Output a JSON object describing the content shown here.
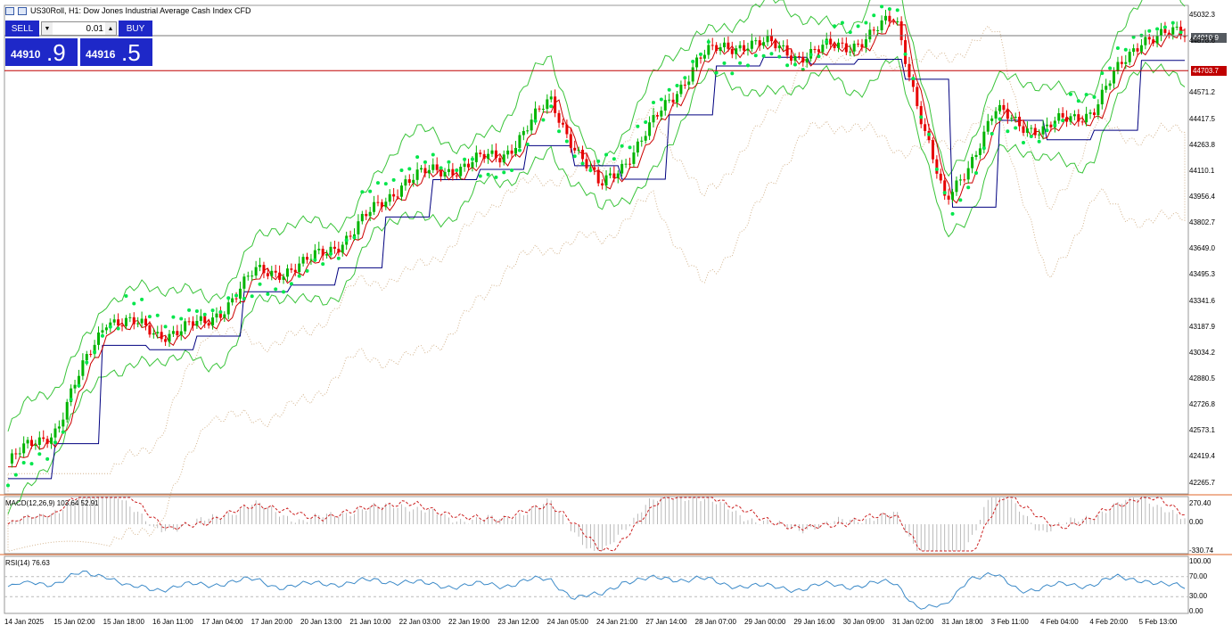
{
  "window": {
    "title": "US30Roll, H1:  Dow Jones Industrial Average Cash Index CFD"
  },
  "trade_panel": {
    "sell_label": "SELL",
    "buy_label": "BUY",
    "lot_value": "0.01",
    "bid_small": "44910",
    "bid_big": ".9",
    "ask_small": "44916",
    "ask_big": ".5",
    "colors": {
      "button": "#1e28c8",
      "text": "#ffffff"
    }
  },
  "main_chart": {
    "y_labels": [
      "45032.3",
      "44878.6",
      "44571.2",
      "44417.5",
      "44263.8",
      "44110.1",
      "43956.4",
      "43802.7",
      "43649.0",
      "43495.3",
      "43341.6",
      "43187.9",
      "43034.2",
      "42880.5",
      "42726.8",
      "42573.1",
      "42419.4",
      "42265.7"
    ],
    "current_price_tag": "44910.9",
    "level_tag": "44703.7",
    "colors": {
      "bull": "#00b400",
      "bear": "#e60000",
      "sar": "#00e64b",
      "bands": "#3ac43a",
      "kijun": "#000080",
      "tenkan": "#cc0000",
      "cloud": "#c8a070",
      "level": "#c00000"
    }
  },
  "macd": {
    "title": "MACD(12,26,9) 103.64 52.91",
    "y_labels": [
      "270.40",
      "0.00",
      "-330.74"
    ]
  },
  "rsi": {
    "title": "RSI(14) 76.63",
    "y_labels": [
      "100.00",
      "70.00",
      "30.00",
      "0.00"
    ]
  },
  "x_labels": [
    "14 Jan 2025",
    "15 Jan 02:00",
    "15 Jan 18:00",
    "16 Jan 11:00",
    "17 Jan 04:00",
    "17 Jan 20:00",
    "20 Jan 13:00",
    "21 Jan 10:00",
    "22 Jan 03:00",
    "22 Jan 19:00",
    "23 Jan 12:00",
    "24 Jan 05:00",
    "24 Jan 21:00",
    "27 Jan 14:00",
    "28 Jan 07:00",
    "29 Jan 00:00",
    "29 Jan 16:00",
    "30 Jan 09:00",
    "31 Jan 02:00",
    "31 Jan 18:00",
    "3 Feb 11:00",
    "4 Feb 04:00",
    "4 Feb 20:00",
    "5 Feb 13:00"
  ],
  "chart_data": {
    "type": "candlestick",
    "symbol": "US30Roll",
    "timeframe": "H1",
    "ylim": [
      42200,
      45090
    ],
    "close_path": [
      {
        "x": "14 Jan 2025",
        "y": 42380
      },
      {
        "x": "15 Jan 02:00",
        "y": 42600
      },
      {
        "x": "15 Jan 18:00",
        "y": 43250
      },
      {
        "x": "16 Jan 11:00",
        "y": 43150
      },
      {
        "x": "17 Jan 04:00",
        "y": 43200
      },
      {
        "x": "17 Jan 20:00",
        "y": 43500
      },
      {
        "x": "20 Jan 13:00",
        "y": 43550
      },
      {
        "x": "21 Jan 10:00",
        "y": 43750
      },
      {
        "x": "22 Jan 03:00",
        "y": 44050
      },
      {
        "x": "22 Jan 19:00",
        "y": 44130
      },
      {
        "x": "23 Jan 12:00",
        "y": 44200
      },
      {
        "x": "24 Jan 05:00",
        "y": 44520
      },
      {
        "x": "24 Jan 21:00",
        "y": 44000
      },
      {
        "x": "27 Jan 14:00",
        "y": 44350
      },
      {
        "x": "28 Jan 07:00",
        "y": 44780
      },
      {
        "x": "29 Jan 00:00",
        "y": 44880
      },
      {
        "x": "29 Jan 16:00",
        "y": 44800
      },
      {
        "x": "30 Jan 09:00",
        "y": 44850
      },
      {
        "x": "31 Jan 02:00",
        "y": 45000
      },
      {
        "x": "31 Jan 18:00",
        "y": 43900
      },
      {
        "x": "3 Feb 11:00",
        "y": 44450
      },
      {
        "x": "4 Feb 04:00",
        "y": 44350
      },
      {
        "x": "4 Feb 20:00",
        "y": 44480
      },
      {
        "x": "5 Feb 13:00",
        "y": 44910.9
      }
    ],
    "bid": 44910.9,
    "ask": 44916.5,
    "level": 44703.7,
    "indicators": [
      "Ichimoku",
      "Parabolic SAR",
      "Bands",
      "MACD(12,26,9)",
      "RSI(14)"
    ],
    "macd": {
      "main": 103.64,
      "signal": 52.91,
      "ylim": [
        -330.74,
        270.4
      ]
    },
    "rsi": {
      "value": 76.63,
      "levels": [
        70,
        30
      ],
      "ylim": [
        0,
        100
      ]
    }
  }
}
